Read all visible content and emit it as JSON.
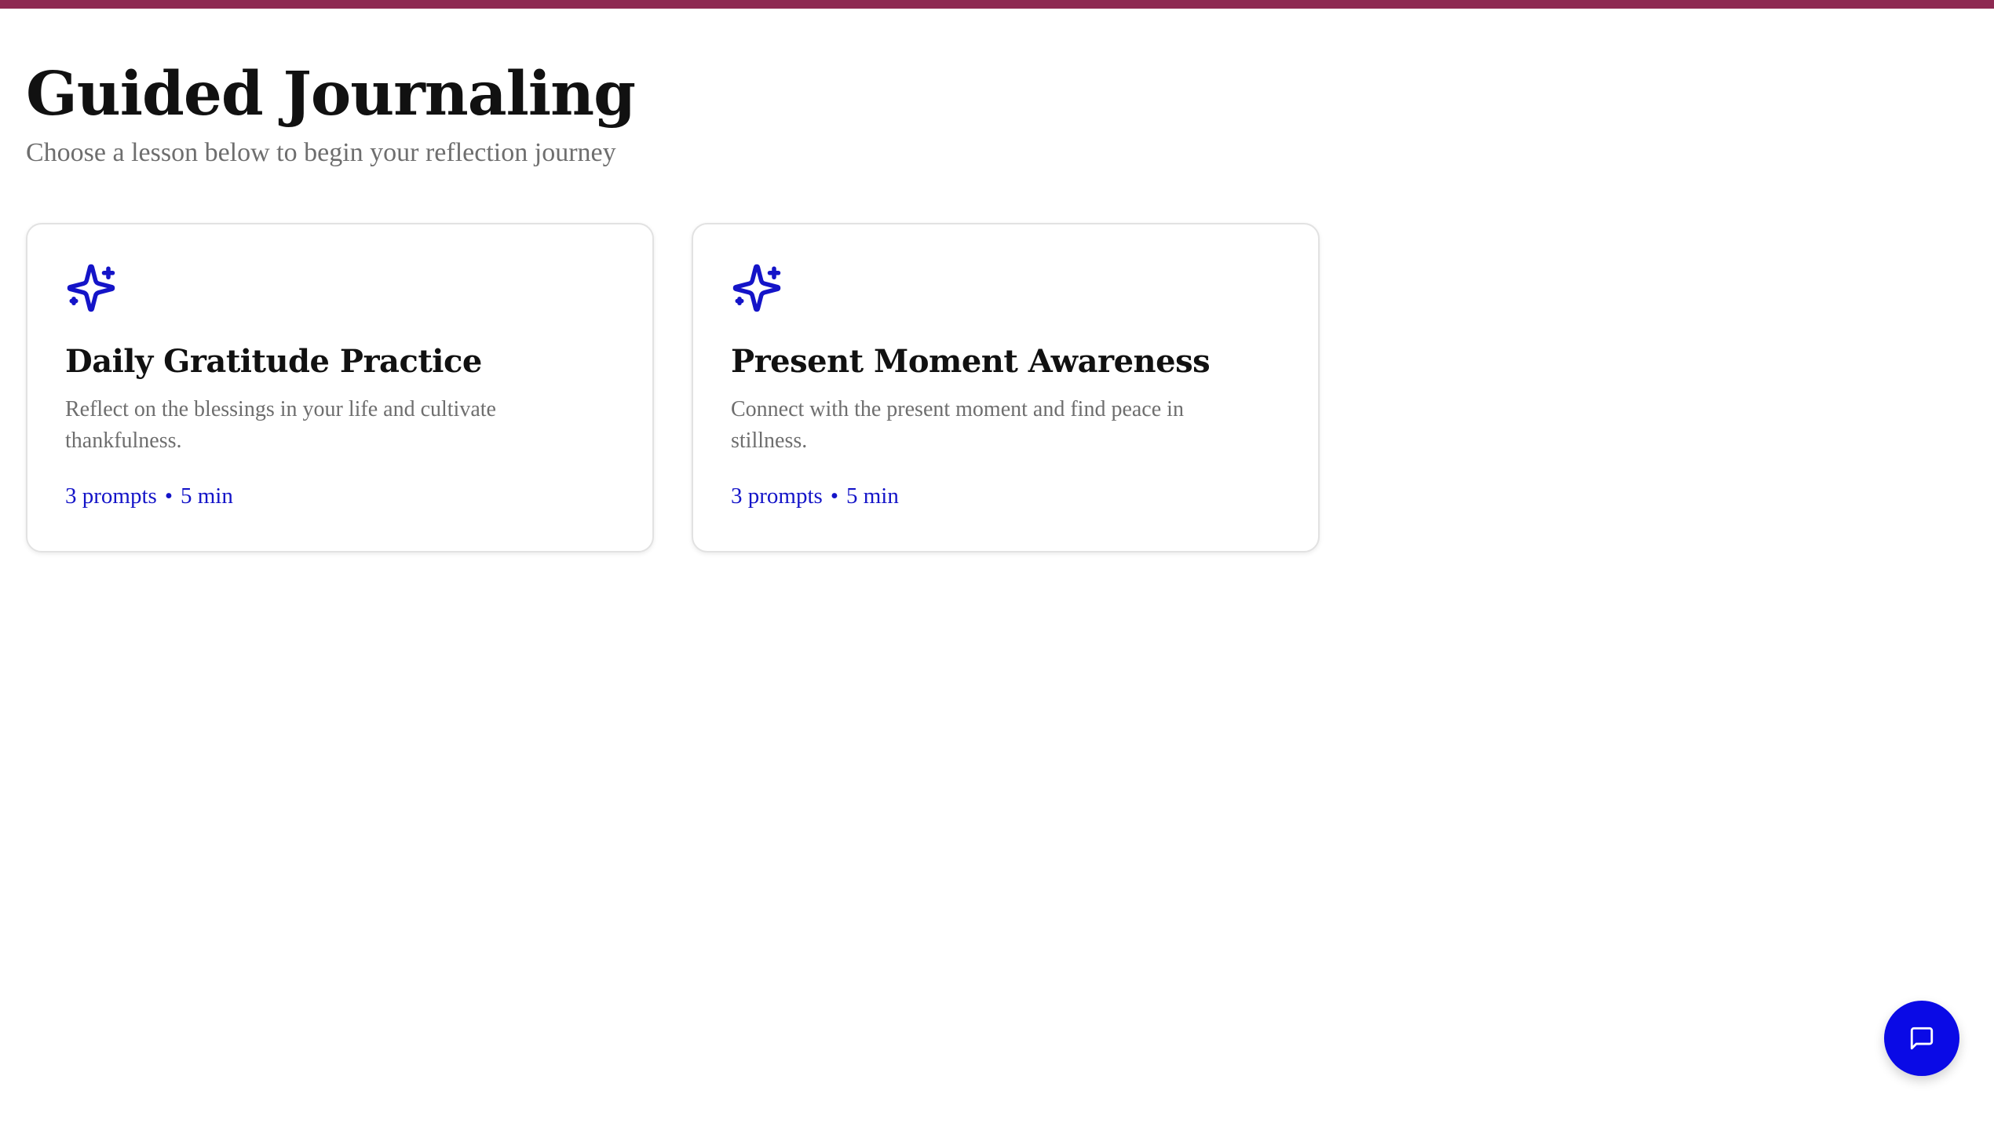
{
  "header": {
    "title": "Guided Journaling",
    "subtitle": "Choose a lesson below to begin your reflection journey"
  },
  "lessons": [
    {
      "icon": "sparkles-icon",
      "title": "Daily Gratitude Practice",
      "description": "Reflect on the blessings in your life and cultivate thankfulness.",
      "prompts": "3 prompts",
      "separator": "•",
      "duration": "5 min"
    },
    {
      "icon": "sparkles-icon",
      "title": "Present Moment Awareness",
      "description": "Connect with the present moment and find peace in stillness.",
      "prompts": "3 prompts",
      "separator": "•",
      "duration": "5 min"
    }
  ],
  "chat_button": {
    "icon": "chat-bubble-icon"
  },
  "colors": {
    "top_bar": "#8e2a52",
    "accent": "#1414c8",
    "fab": "#0a0ae6",
    "title": "#111111",
    "muted": "#6e6e6e"
  }
}
